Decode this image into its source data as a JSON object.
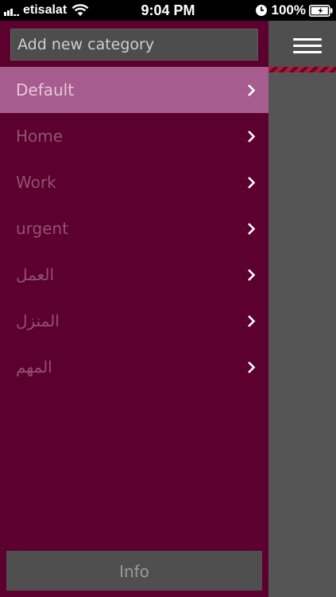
{
  "status_bar": {
    "carrier": "etisalat",
    "time": "9:04 PM",
    "battery": "100%"
  },
  "menu": {
    "add_placeholder": "Add new category",
    "categories": [
      {
        "label": "Default",
        "selected": true
      },
      {
        "label": "Home",
        "selected": false
      },
      {
        "label": "Work",
        "selected": false
      },
      {
        "label": "urgent",
        "selected": false
      },
      {
        "label": "العمل",
        "selected": false
      },
      {
        "label": "المنزل",
        "selected": false
      },
      {
        "label": "المهم",
        "selected": false
      }
    ],
    "info_label": "Info"
  },
  "colors": {
    "menu_background": "#5c0030",
    "selected_row": "#a65c8e",
    "main_panel": "#555555",
    "ribbon": "#b0183c"
  },
  "icons": {
    "status": [
      "signal-icon",
      "wifi-icon",
      "alarm-icon",
      "battery-icon"
    ],
    "row": "chevron-right-icon",
    "header": "hamburger-menu-icon"
  }
}
